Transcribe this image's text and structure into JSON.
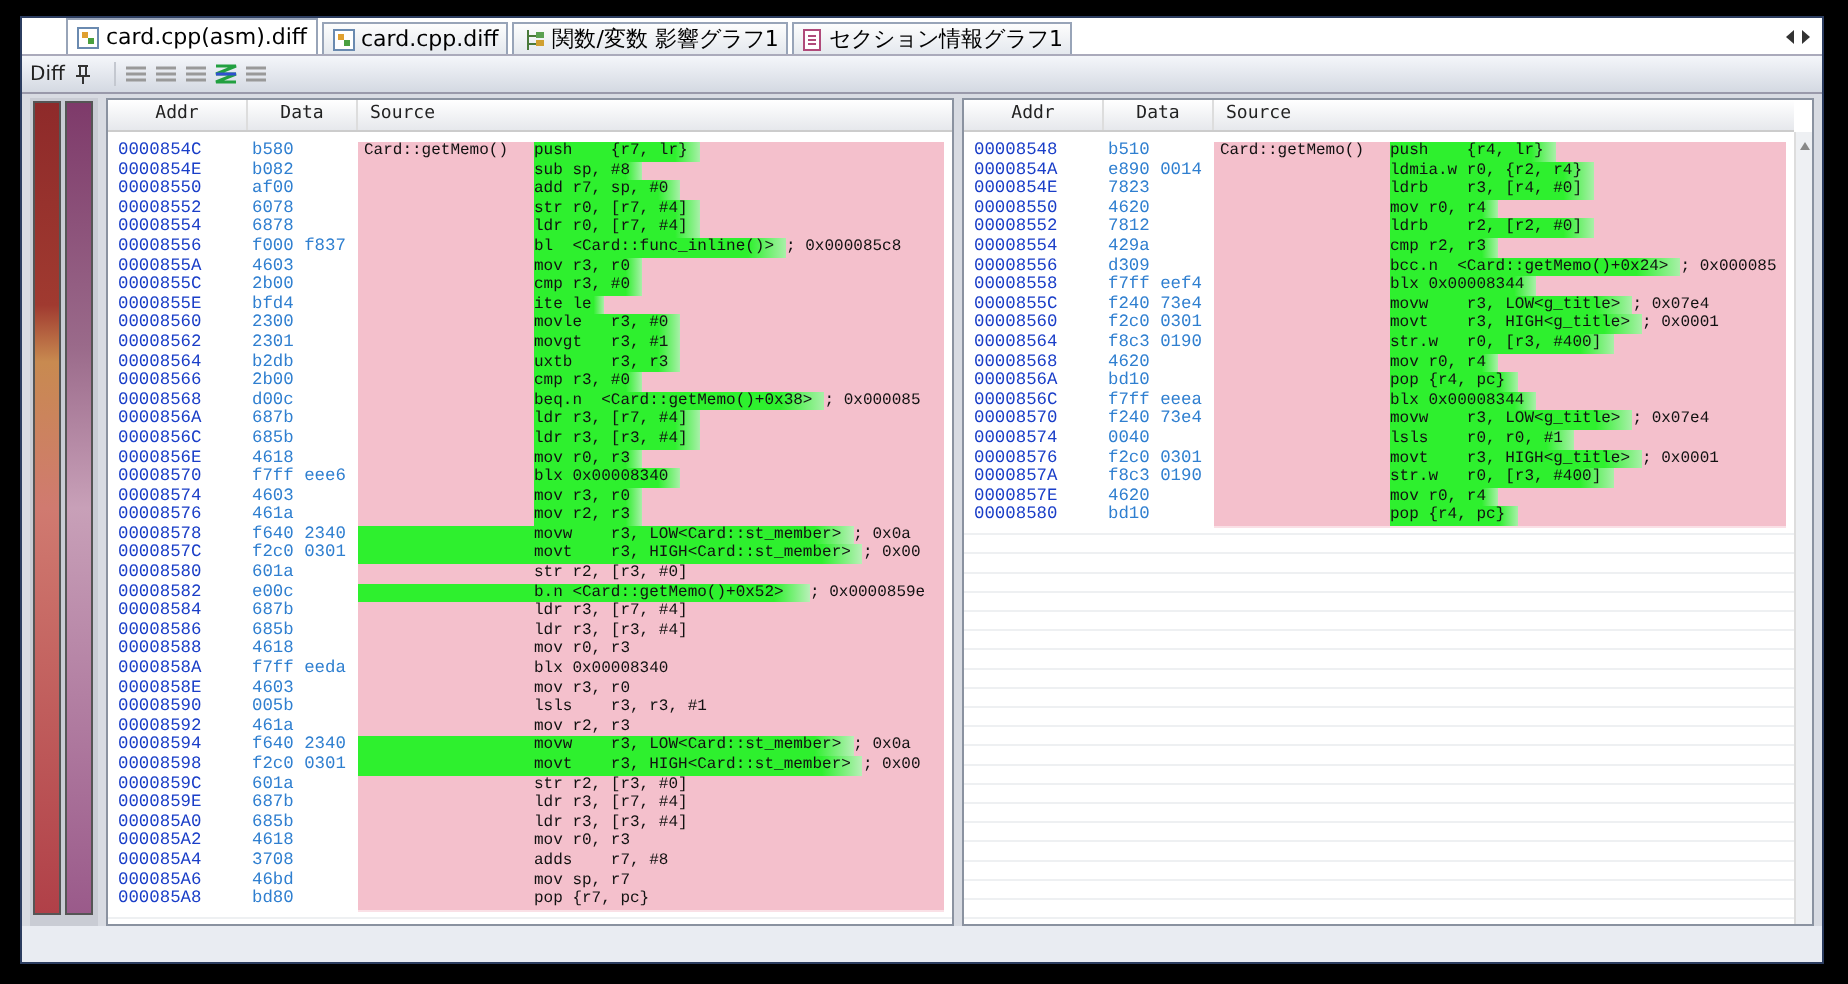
{
  "tabs": [
    {
      "label": "card.cpp(asm).diff",
      "selected": true
    },
    {
      "label": "card.cpp.diff",
      "selected": false
    },
    {
      "label": "関数/変数 影響グラフ1",
      "selected": false
    },
    {
      "label": "セクション情報グラフ1",
      "selected": false
    }
  ],
  "toolbar": {
    "title": "Diff"
  },
  "panels": [
    {
      "columns": [
        "Addr",
        "Data",
        "Source"
      ],
      "rows": [
        {
          "addr": "0000854C",
          "data": "b580",
          "label": "Card::getMemo()",
          "instr": "push    {r7, lr}",
          "kind": "partial"
        },
        {
          "addr": "0000854E",
          "data": "b082",
          "instr": "sub sp, #8",
          "kind": "partial"
        },
        {
          "addr": "00008550",
          "data": "af00",
          "instr": "add r7, sp, #0",
          "kind": "partial"
        },
        {
          "addr": "00008552",
          "data": "6078",
          "instr": "str r0, [r7, #4]",
          "kind": "partial"
        },
        {
          "addr": "00008554",
          "data": "6878",
          "instr": "ldr r0, [r7, #4]",
          "kind": "partial"
        },
        {
          "addr": "00008556",
          "data": "f000 f837",
          "instr": "bl  <Card::func_inline()>",
          "comment": "; 0x000085c8",
          "kind": "partial"
        },
        {
          "addr": "0000855A",
          "data": "4603",
          "instr": "mov r3, r0",
          "kind": "partial"
        },
        {
          "addr": "0000855C",
          "data": "2b00",
          "instr": "cmp r3, #0",
          "kind": "partial"
        },
        {
          "addr": "0000855E",
          "data": "bfd4",
          "instr": "ite le",
          "kind": "partial"
        },
        {
          "addr": "00008560",
          "data": "2300",
          "instr": "movle   r3, #0",
          "kind": "partial"
        },
        {
          "addr": "00008562",
          "data": "2301",
          "instr": "movgt   r3, #1",
          "kind": "partial"
        },
        {
          "addr": "00008564",
          "data": "b2db",
          "instr": "uxtb    r3, r3",
          "kind": "partial"
        },
        {
          "addr": "00008566",
          "data": "2b00",
          "instr": "cmp r3, #0",
          "kind": "partial"
        },
        {
          "addr": "00008568",
          "data": "d00c",
          "instr": "beq.n  <Card::getMemo()+0x38>",
          "comment": "; 0x000085",
          "kind": "partial"
        },
        {
          "addr": "0000856A",
          "data": "687b",
          "instr": "ldr r3, [r7, #4]",
          "kind": "partial"
        },
        {
          "addr": "0000856C",
          "data": "685b",
          "instr": "ldr r3, [r3, #4]",
          "kind": "partial"
        },
        {
          "addr": "0000856E",
          "data": "4618",
          "instr": "mov r0, r3",
          "kind": "partial"
        },
        {
          "addr": "00008570",
          "data": "f7ff eee6",
          "instr": "blx 0x00008340",
          "kind": "partial"
        },
        {
          "addr": "00008574",
          "data": "4603",
          "instr": "mov r3, r0",
          "kind": "partial"
        },
        {
          "addr": "00008576",
          "data": "461a",
          "instr": "mov r2, r3",
          "kind": "partial"
        },
        {
          "addr": "00008578",
          "data": "f640 2340",
          "instr": "movw    r3, LOW<Card::st_member>",
          "comment": "; 0x0a",
          "kind": "wide"
        },
        {
          "addr": "0000857C",
          "data": "f2c0 0301",
          "instr": "movt    r3, HIGH<Card::st_member>",
          "comment": "; 0x00",
          "kind": "wide"
        },
        {
          "addr": "00008580",
          "data": "601a",
          "instr": "str r2, [r3, #0]",
          "kind": "plain"
        },
        {
          "addr": "00008582",
          "data": "e00c",
          "instr": "b.n <Card::getMemo()+0x52>",
          "comment": "; 0x0000859e",
          "kind": "wide"
        },
        {
          "addr": "00008584",
          "data": "687b",
          "instr": "ldr r3, [r7, #4]",
          "kind": "plain"
        },
        {
          "addr": "00008586",
          "data": "685b",
          "instr": "ldr r3, [r3, #4]",
          "kind": "plain"
        },
        {
          "addr": "00008588",
          "data": "4618",
          "instr": "mov r0, r3",
          "kind": "plain"
        },
        {
          "addr": "0000858A",
          "data": "f7ff eeda",
          "instr": "blx 0x00008340",
          "kind": "plain"
        },
        {
          "addr": "0000858E",
          "data": "4603",
          "instr": "mov r3, r0",
          "kind": "plain"
        },
        {
          "addr": "00008590",
          "data": "005b",
          "instr": "lsls    r3, r3, #1",
          "kind": "plain"
        },
        {
          "addr": "00008592",
          "data": "461a",
          "instr": "mov r2, r3",
          "kind": "plain"
        },
        {
          "addr": "00008594",
          "data": "f640 2340",
          "instr": "movw    r3, LOW<Card::st_member>",
          "comment": "; 0x0a",
          "kind": "wide"
        },
        {
          "addr": "00008598",
          "data": "f2c0 0301",
          "instr": "movt    r3, HIGH<Card::st_member>",
          "comment": "; 0x00",
          "kind": "wide"
        },
        {
          "addr": "0000859C",
          "data": "601a",
          "instr": "str r2, [r3, #0]",
          "kind": "plain"
        },
        {
          "addr": "0000859E",
          "data": "687b",
          "instr": "ldr r3, [r7, #4]",
          "kind": "plain"
        },
        {
          "addr": "000085A0",
          "data": "685b",
          "instr": "ldr r3, [r3, #4]",
          "kind": "plain"
        },
        {
          "addr": "000085A2",
          "data": "4618",
          "instr": "mov r0, r3",
          "kind": "plain"
        },
        {
          "addr": "000085A4",
          "data": "3708",
          "instr": "adds    r7, #8",
          "kind": "plain"
        },
        {
          "addr": "000085A6",
          "data": "46bd",
          "instr": "mov sp, r7",
          "kind": "plain"
        },
        {
          "addr": "000085A8",
          "data": "bd80",
          "instr": "pop {r7, pc}",
          "kind": "plain"
        }
      ]
    },
    {
      "columns": [
        "Addr",
        "Data",
        "Source"
      ],
      "rows": [
        {
          "addr": "00008548",
          "data": "b510",
          "label": "Card::getMemo()",
          "instr": "push    {r4, lr}",
          "kind": "partial"
        },
        {
          "addr": "0000854A",
          "data": "e890 0014",
          "instr": "ldmia.w r0, {r2, r4}",
          "kind": "partial"
        },
        {
          "addr": "0000854E",
          "data": "7823",
          "instr": "ldrb    r3, [r4, #0]",
          "kind": "partial"
        },
        {
          "addr": "00008550",
          "data": "4620",
          "instr": "mov r0, r4",
          "kind": "partial"
        },
        {
          "addr": "00008552",
          "data": "7812",
          "instr": "ldrb    r2, [r2, #0]",
          "kind": "partial"
        },
        {
          "addr": "00008554",
          "data": "429a",
          "instr": "cmp r2, r3",
          "kind": "partial"
        },
        {
          "addr": "00008556",
          "data": "d309",
          "instr": "bcc.n  <Card::getMemo()+0x24>",
          "comment": "; 0x000085",
          "kind": "partial"
        },
        {
          "addr": "00008558",
          "data": "f7ff eef4",
          "instr": "blx 0x00008344",
          "kind": "partial"
        },
        {
          "addr": "0000855C",
          "data": "f240 73e4",
          "instr": "movw    r3, LOW<g_title>",
          "comment": "; 0x07e4",
          "kind": "partial"
        },
        {
          "addr": "00008560",
          "data": "f2c0 0301",
          "instr": "movt    r3, HIGH<g_title>",
          "comment": "; 0x0001",
          "kind": "partial"
        },
        {
          "addr": "00008564",
          "data": "f8c3 0190",
          "instr": "str.w   r0, [r3, #400]",
          "kind": "partial"
        },
        {
          "addr": "00008568",
          "data": "4620",
          "instr": "mov r0, r4",
          "kind": "partial"
        },
        {
          "addr": "0000856A",
          "data": "bd10",
          "instr": "pop {r4, pc}",
          "kind": "partial"
        },
        {
          "addr": "0000856C",
          "data": "f7ff eeea",
          "instr": "blx 0x00008344",
          "kind": "partial"
        },
        {
          "addr": "00008570",
          "data": "f240 73e4",
          "instr": "movw    r3, LOW<g_title>",
          "comment": "; 0x07e4",
          "kind": "partial"
        },
        {
          "addr": "00008574",
          "data": "0040",
          "instr": "lsls    r0, r0, #1",
          "kind": "partial"
        },
        {
          "addr": "00008576",
          "data": "f2c0 0301",
          "instr": "movt    r3, HIGH<g_title>",
          "comment": "; 0x0001",
          "kind": "partial"
        },
        {
          "addr": "0000857A",
          "data": "f8c3 0190",
          "instr": "str.w   r0, [r3, #400]",
          "kind": "partial"
        },
        {
          "addr": "0000857E",
          "data": "4620",
          "instr": "mov r0, r4",
          "kind": "partial"
        },
        {
          "addr": "00008580",
          "data": "bd10",
          "instr": "pop {r4, pc}",
          "kind": "partial"
        }
      ]
    }
  ]
}
